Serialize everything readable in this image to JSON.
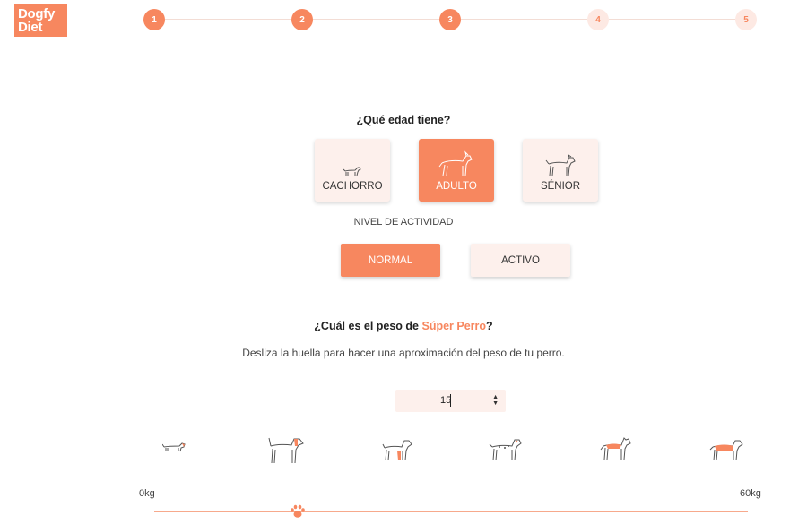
{
  "brand": {
    "line1": "Dogfy",
    "line2": "Diet"
  },
  "steps": [
    {
      "label": "1",
      "state": "done"
    },
    {
      "label": "2",
      "state": "done"
    },
    {
      "label": "3",
      "state": "done"
    },
    {
      "label": "4",
      "state": "todo"
    },
    {
      "label": "5",
      "state": "todo"
    }
  ],
  "age": {
    "question": "¿Qué edad tiene?",
    "options": [
      {
        "label": "CACHORRO",
        "icon": "puppy-icon",
        "selected": false
      },
      {
        "label": "ADULTO",
        "icon": "adult-dog-icon",
        "selected": true
      },
      {
        "label": "SÉNIOR",
        "icon": "senior-dog-icon",
        "selected": false
      }
    ]
  },
  "activity": {
    "title": "NIVEL DE ACTIVIDAD",
    "options": [
      {
        "label": "NORMAL",
        "selected": true
      },
      {
        "label": "ACTIVO",
        "selected": false
      }
    ]
  },
  "weight": {
    "question_prefix": "¿Cuál es el peso de ",
    "dog_name": "Súper Perro",
    "question_suffix": "?",
    "description": "Desliza la huella para hacer una aproximación del peso de tu perro.",
    "value": "15",
    "min_label": "0kg",
    "max_label": "60kg",
    "slider_value_kg": 15
  },
  "dog_scale_icons": [
    "dachshund-icon",
    "beagle-icon",
    "spaniel-icon",
    "dalmatian-icon",
    "shepherd-icon",
    "large-dog-icon"
  ],
  "colors": {
    "accent": "#f7875f",
    "light": "#fdf0ec"
  }
}
